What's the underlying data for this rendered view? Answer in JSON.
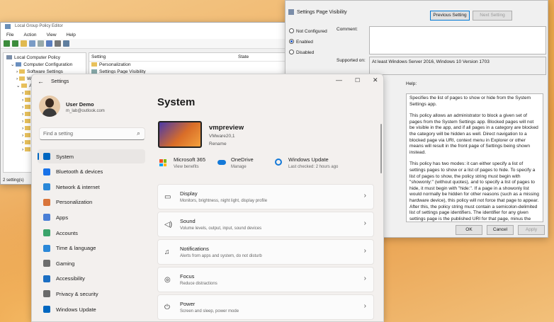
{
  "gpe": {
    "title": "Local Group Policy Editor",
    "menu": [
      "File",
      "Action",
      "View",
      "Help"
    ],
    "tree": [
      "Local Computer Policy",
      "Computer Configuration",
      "Software Settings",
      "W",
      "A",
      "",
      ""
    ],
    "col_setting": "Setting",
    "col_state": "State",
    "rows": [
      "Personalization",
      "Settings Page Visibility"
    ],
    "status": "2 setting(s)"
  },
  "policy": {
    "title": "Settings Page Visibility",
    "prev": "Previous Setting",
    "next": "Next Setting",
    "not_configured": "Not Configured",
    "enabled": "Enabled",
    "disabled": "Disabled",
    "comment": "Comment:",
    "supported_label": "Supported on:",
    "supported_value": "At least Windows Server 2016, Windows 10 Version 1703",
    "help": "Help:",
    "help_p1": "Specifies the list of pages to show or hide from the System Settings app.",
    "help_p2": "This policy allows an administrator to block a given set of pages from the System Settings app. Blocked pages will not be visible in the app, and if all pages in a category are blocked the category will be hidden as well. Direct navigation to a blocked page via URI, context menu in Explorer or other means will result in the front page of Settings being shown instead.",
    "help_p3": "This policy has two modes: it can either specify a list of settings pages to show or a list of pages to hide. To specify a list of pages to show, the policy string must begin with \"showonly:\" (without quotes), and to specify a list of pages to hide, it must begin with \"hide:\". If a page in a showonly list would normally be hidden for other reasons (such as a missing hardware device), this policy will not force that page to appear. After this, the policy string must contain a semicolon-delimited list of settings page identifiers. The identifier for any given settings page is the published URI for that page, minus the \"ms-settings:\" protocol part.",
    "ok": "OK",
    "cancel": "Cancel",
    "apply": "Apply"
  },
  "settings": {
    "title": "Settings",
    "user_name": "User Demo",
    "user_email": "m_lab@outlook.com",
    "search_placeholder": "Find a setting",
    "heading": "System",
    "device_name": "vmpreview",
    "device_model": "VMware20,1",
    "rename": "Rename",
    "quick": [
      {
        "t": "Microsoft 365",
        "s": "View benefits"
      },
      {
        "t": "OneDrive",
        "s": "Manage"
      },
      {
        "t": "Windows Update",
        "s": "Last checked: 2 hours ago"
      }
    ],
    "nav": [
      "System",
      "Bluetooth & devices",
      "Network & internet",
      "Personalization",
      "Apps",
      "Accounts",
      "Time & language",
      "Gaming",
      "Accessibility",
      "Privacy & security",
      "Windows Update"
    ],
    "nav_colors": [
      "#0067c0",
      "#1a73e8",
      "#2b88d8",
      "#d9743a",
      "#4a7fd6",
      "#3aa36a",
      "#2b88d8",
      "#6d6d6d",
      "#1b6ec2",
      "#6b6b6b",
      "#0067c0"
    ],
    "cards": [
      {
        "t": "Display",
        "s": "Monitors, brightness, night light, display profile"
      },
      {
        "t": "Sound",
        "s": "Volume levels, output, input, sound devices"
      },
      {
        "t": "Notifications",
        "s": "Alerts from apps and system, do not disturb"
      },
      {
        "t": "Focus",
        "s": "Reduce distractions"
      },
      {
        "t": "Power",
        "s": "Screen and sleep, power mode"
      }
    ]
  }
}
